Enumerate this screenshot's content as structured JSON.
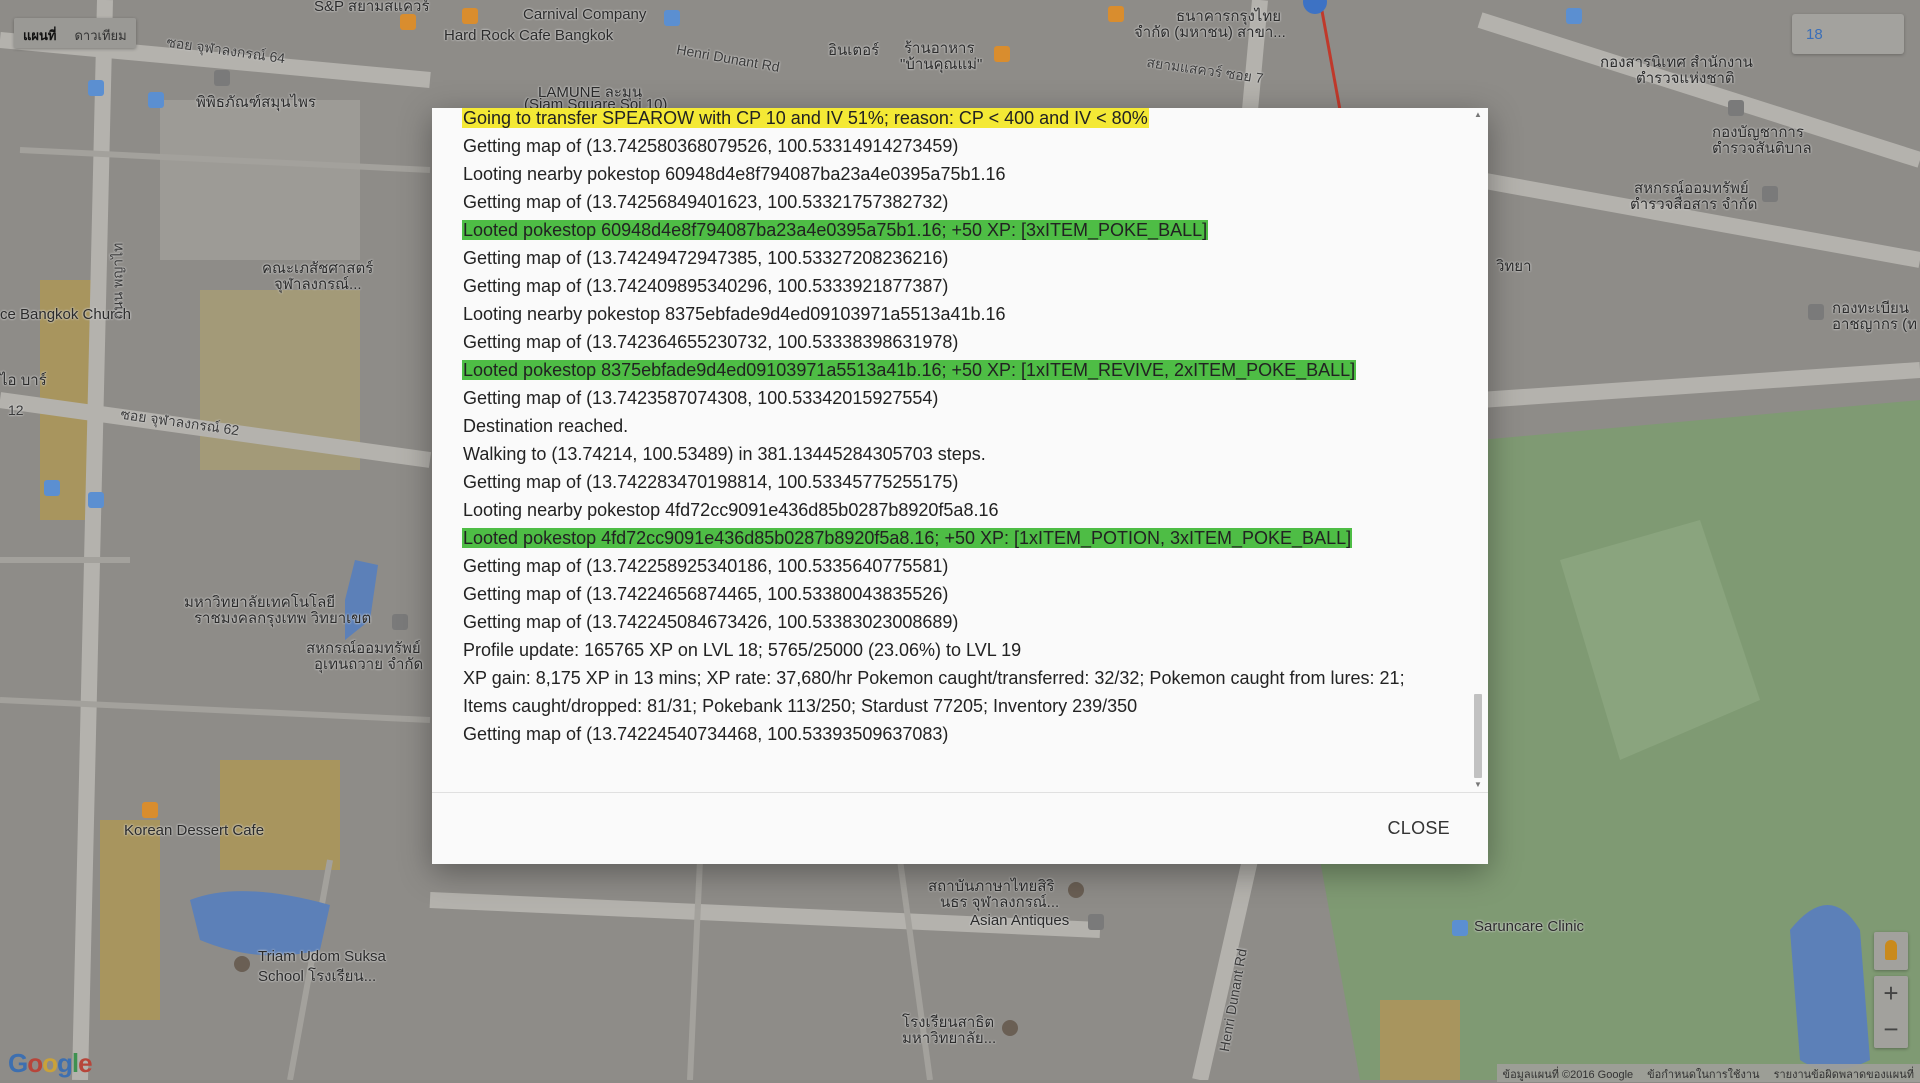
{
  "map": {
    "type_toggle": [
      "แผนที่",
      "ดาวเทียม"
    ],
    "level_box": "18",
    "labels": [
      {
        "text": "S&P สยามสแควร์",
        "name": "map-label-sp"
      },
      {
        "text": "Carnival Company",
        "name": "map-label-carnival"
      },
      {
        "text": "Hard Rock Cafe Bangkok",
        "name": "map-label-hardrock"
      },
      {
        "text": "Henri Dunant Rd",
        "name": "map-label-henri-dunant-top"
      },
      {
        "text": "อินเตอร์",
        "name": "map-label-inter"
      },
      {
        "text": "ร้านอาหาร",
        "name": "map-label-restaurant-1"
      },
      {
        "text": "\"บ้านคุณแม่\"",
        "name": "map-label-restaurant-2"
      },
      {
        "text": "ธนาคารกรุงไทย",
        "name": "map-label-bank-1"
      },
      {
        "text": "จำกัด (มหาชน) สาขา...",
        "name": "map-label-bank-2"
      },
      {
        "text": "สยามแสควร์ ซอย 7",
        "name": "map-label-siam-soi7"
      },
      {
        "text": "กองสารนิเทศ สำนักงาน",
        "name": "map-label-office-1"
      },
      {
        "text": "ตำรวจแห่งชาติ",
        "name": "map-label-office-2"
      },
      {
        "text": "กองบัญชาการ",
        "name": "map-label-command-1"
      },
      {
        "text": "ตำรวจสันติบาล",
        "name": "map-label-command-2"
      },
      {
        "text": "สหกรณ์ออมทรัพย์",
        "name": "map-label-coop-1"
      },
      {
        "text": "ตำรวจสื่อสาร จำกัด",
        "name": "map-label-coop-2"
      },
      {
        "text": "ซอย จุฬาลงกรณ์ 64",
        "name": "map-label-chula-64"
      },
      {
        "text": "พิพิธภัณฑ์สมุนไพร",
        "name": "map-label-museum"
      },
      {
        "text": "LAMUNE ละมุน",
        "name": "map-label-lamune"
      },
      {
        "text": "(Siam Square Soi 10)",
        "name": "map-label-siam-soi10"
      },
      {
        "text": "คณะเภสัชศาสตร์",
        "name": "map-label-pharmacy-1"
      },
      {
        "text": "จุฬาลงกรณ์...",
        "name": "map-label-pharmacy-2"
      },
      {
        "text": "ce Bangkok Church",
        "name": "map-label-church"
      },
      {
        "text": "ไอ บาร์",
        "name": "map-label-bar"
      },
      {
        "text": "12",
        "name": "map-label-12"
      },
      {
        "text": "ซอย จุฬาลงกรณ์ 62",
        "name": "map-label-chula-62"
      },
      {
        "text": "ถนน พญาไท",
        "name": "map-label-phayathai"
      },
      {
        "text": "วิทยา",
        "name": "map-label-wittaya"
      },
      {
        "text": "กองทะเบียน",
        "name": "map-label-registry-1"
      },
      {
        "text": "อาชญากร (ท",
        "name": "map-label-registry-2"
      },
      {
        "text": "มหาวิทยาลัยเทคโนโลยี",
        "name": "map-label-tech-univ-1"
      },
      {
        "text": "ราชมงคลกรุงเทพ วิทยาเขต",
        "name": "map-label-tech-univ-2"
      },
      {
        "text": "สหกรณ์ออมทรัพย์",
        "name": "map-label-coop2-1"
      },
      {
        "text": "อุเทนถวาย จำกัด",
        "name": "map-label-coop2-2"
      },
      {
        "text": "Korean Dessert Cafe",
        "name": "map-label-korean-cafe"
      },
      {
        "text": "สถาบันภาษาไทยสิริ",
        "name": "map-label-thai-inst-1"
      },
      {
        "text": "นธร จุฬาลงกรณ์...",
        "name": "map-label-thai-inst-2"
      },
      {
        "text": "Asian Antiques",
        "name": "map-label-asian-antiques"
      },
      {
        "text": "Henri Dunant Rd",
        "name": "map-label-henri-dunant-bottom"
      },
      {
        "text": "Saruncare Clinic",
        "name": "map-label-saruncare"
      },
      {
        "text": "Triam Udom Suksa",
        "name": "map-label-triam-1"
      },
      {
        "text": "School โรงเรียน...",
        "name": "map-label-triam-2"
      },
      {
        "text": "โรงเรียนสาธิต",
        "name": "map-label-satit-1"
      },
      {
        "text": "มหาวิทยาลัย...",
        "name": "map-label-satit-2"
      }
    ],
    "google_logo": [
      "G",
      "o",
      "o",
      "g",
      "l",
      "e"
    ],
    "attribution": [
      "ข้อมูลแผนที่ ©2016 Google",
      "ข้อกำหนดในการใช้งาน",
      "รายงานข้อผิดพลาดของแผนที่"
    ],
    "zoom_in": "+",
    "zoom_out": "−"
  },
  "dialog": {
    "log": [
      {
        "text": "Going to transfer SPEAROW with CP 10 and IV 51%; reason: CP < 400 and IV < 80%",
        "highlight": "yellow"
      },
      {
        "text": "Getting map of (13.742580368079526, 100.53314914273459)",
        "highlight": ""
      },
      {
        "text": "Looting nearby pokestop 60948d4e8f794087ba23a4e0395a75b1.16",
        "highlight": ""
      },
      {
        "text": "Getting map of (13.74256849401623, 100.53321757382732)",
        "highlight": ""
      },
      {
        "text": "Looted pokestop 60948d4e8f794087ba23a4e0395a75b1.16; +50 XP: [3xITEM_POKE_BALL]",
        "highlight": "green"
      },
      {
        "text": "Getting map of (13.74249472947385, 100.53327208236216)",
        "highlight": ""
      },
      {
        "text": "Getting map of (13.742409895340296, 100.5333921877387)",
        "highlight": ""
      },
      {
        "text": "Looting nearby pokestop 8375ebfade9d4ed09103971a5513a41b.16",
        "highlight": ""
      },
      {
        "text": "Getting map of (13.742364655230732, 100.53338398631978)",
        "highlight": ""
      },
      {
        "text": "Looted pokestop 8375ebfade9d4ed09103971a5513a41b.16; +50 XP: [1xITEM_REVIVE, 2xITEM_POKE_BALL]",
        "highlight": "green"
      },
      {
        "text": "Getting map of (13.7423587074308, 100.53342015927554)",
        "highlight": ""
      },
      {
        "text": "Destination reached.",
        "highlight": ""
      },
      {
        "text": "Walking to (13.74214, 100.53489) in 381.13445284305703 steps.",
        "highlight": ""
      },
      {
        "text": "Getting map of (13.742283470198814, 100.53345775255175)",
        "highlight": ""
      },
      {
        "text": "Looting nearby pokestop 4fd72cc9091e436d85b0287b8920f5a8.16",
        "highlight": ""
      },
      {
        "text": "Looted pokestop 4fd72cc9091e436d85b0287b8920f5a8.16; +50 XP: [1xITEM_POTION, 3xITEM_POKE_BALL]",
        "highlight": "green"
      },
      {
        "text": "Getting map of (13.742258925340186, 100.5335640775581)",
        "highlight": ""
      },
      {
        "text": "Getting map of (13.74224656874465, 100.53380043835526)",
        "highlight": ""
      },
      {
        "text": "Getting map of (13.742245084673426, 100.53383023008689)",
        "highlight": ""
      },
      {
        "text": "Profile update: 165765 XP on LVL 18; 5765/25000 (23.06%) to LVL 19",
        "highlight": ""
      },
      {
        "text": "XP gain: 8,175 XP in 13 mins; XP rate: 37,680/hr Pokemon caught/transferred: 32/32; Pokemon caught from lures: 21;",
        "highlight": ""
      },
      {
        "text": "Items caught/dropped: 81/31; Pokebank 113/250; Stardust 77205; Inventory 239/350",
        "highlight": ""
      },
      {
        "text": "Getting map of (13.74224540734468, 100.53393509637083)",
        "highlight": ""
      }
    ],
    "close_label": "CLOSE",
    "scroll_up_icon": "▲",
    "scroll_down_icon": "▼"
  },
  "colors": {
    "highlight_yellow": "#f4e935",
    "highlight_green": "#4ebd45"
  }
}
